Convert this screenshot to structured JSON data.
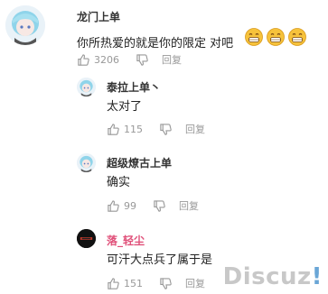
{
  "comments": [
    {
      "username": "龙门上单",
      "text": "你所热爱的就是你的限定 对吧",
      "emoji": "grin-emoji",
      "likes": "3206",
      "reply_label": "回复"
    },
    {
      "username": "泰拉上单丶",
      "text": "太对了",
      "likes": "115",
      "reply_label": "回复"
    },
    {
      "username": "超级燎古上单",
      "text": "确实",
      "likes": "99",
      "reply_label": "回复"
    },
    {
      "username": "落_轻尘",
      "text": "可汗大点兵了属于是",
      "likes": "151",
      "reply_label": "回复"
    }
  ],
  "watermark": {
    "main": "Discuz",
    "excl": "!"
  },
  "colors": {
    "username_highlight": "#e0517a",
    "muted": "#999999",
    "emoji_yellow": "#f6c23b"
  }
}
